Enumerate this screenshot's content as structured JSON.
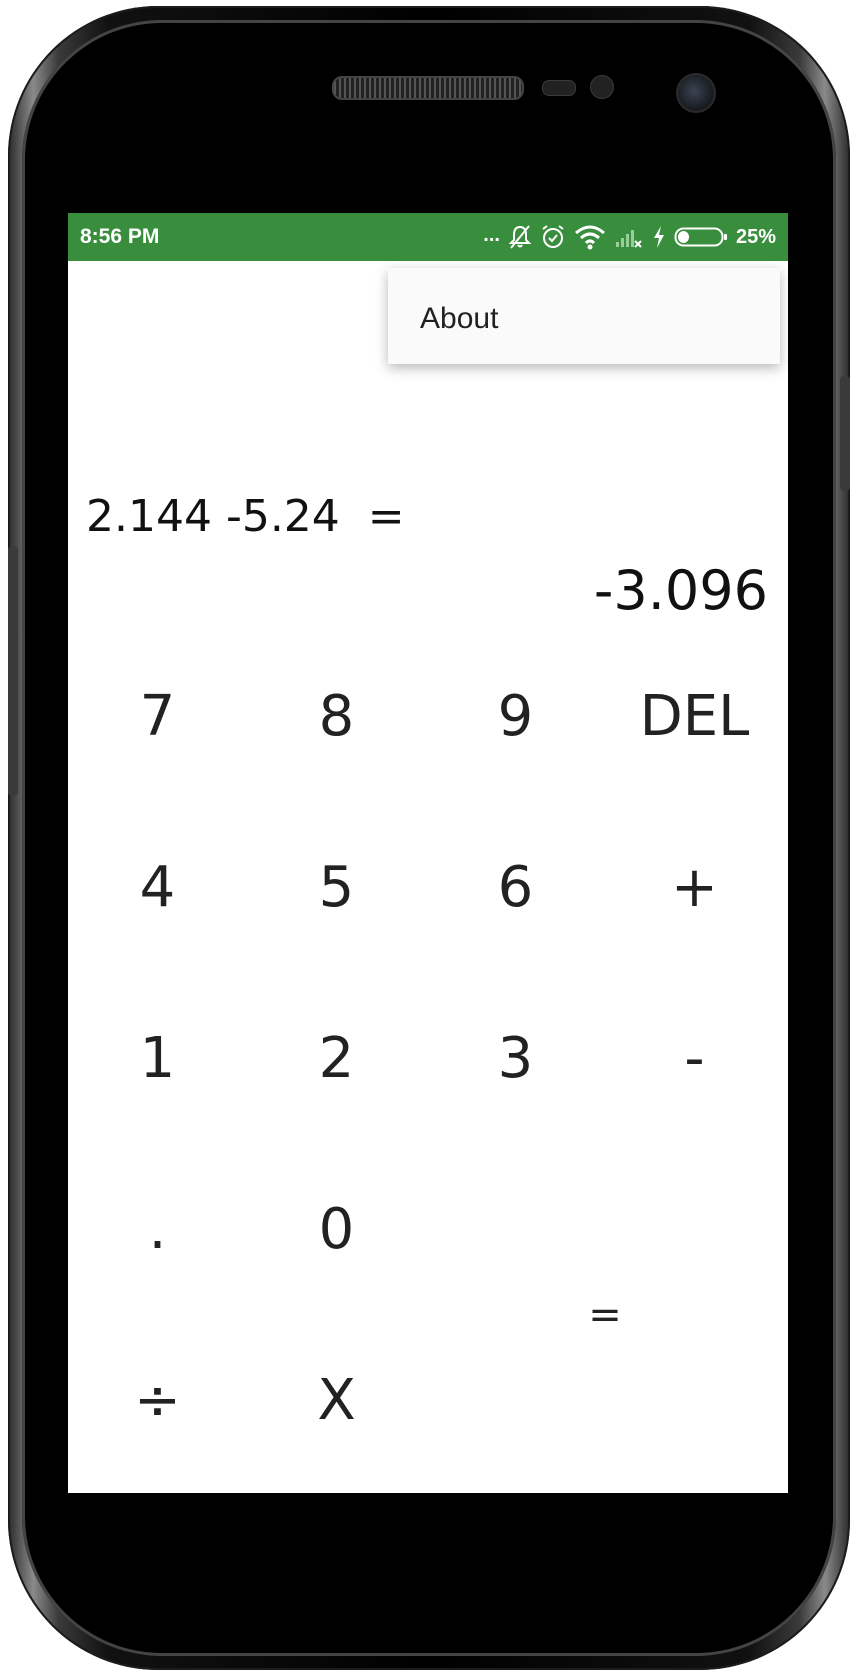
{
  "status_bar": {
    "time": "8:56 PM",
    "overflow_dots": "...",
    "battery_percent": "25%",
    "color": "#388e3c",
    "icons": [
      "more-notifications-icon",
      "notifications-muted-icon",
      "alarm-icon",
      "wifi-icon",
      "no-signal-icon",
      "charging-icon",
      "battery-icon"
    ]
  },
  "menu": {
    "items": [
      {
        "label": "About"
      }
    ]
  },
  "display": {
    "expression": "2.144 -5.24  =",
    "result": "-3.096"
  },
  "keypad": {
    "rows": [
      [
        "7",
        "8",
        "9",
        "DEL"
      ],
      [
        "4",
        "5",
        "6",
        "+"
      ],
      [
        "1",
        "2",
        "3",
        "-"
      ],
      [
        ".",
        "0"
      ],
      [
        "÷",
        "X"
      ]
    ],
    "equals": "="
  }
}
